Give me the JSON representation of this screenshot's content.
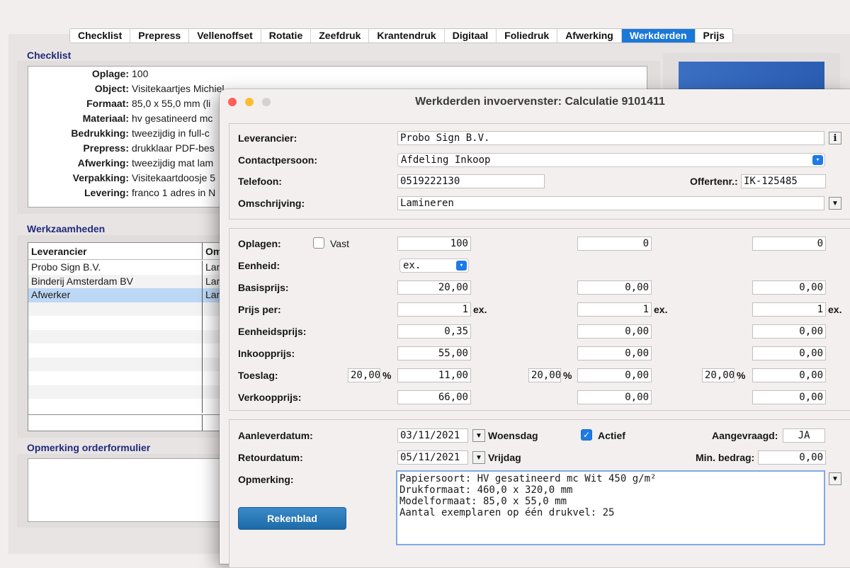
{
  "tabs": [
    "Checklist",
    "Prepress",
    "Vellenoffset",
    "Rotatie",
    "Zeefdruk",
    "Krantendruk",
    "Digitaal",
    "Foliedruk",
    "Afwerking",
    "Werkderden",
    "Prijs"
  ],
  "checklist": {
    "title": "Checklist",
    "rows": [
      {
        "label": "Oplage:",
        "value": "100"
      },
      {
        "label": "Object:",
        "value": "Visitekaartjes Michiel"
      },
      {
        "label": "Formaat:",
        "value": "85,0 x 55,0 mm (li"
      },
      {
        "label": "Materiaal:",
        "value": "hv gesatineerd mc"
      },
      {
        "label": "Bedrukking:",
        "value": "tweezijdig in full-c"
      },
      {
        "label": "Prepress:",
        "value": "drukklaar PDF-bes"
      },
      {
        "label": "Afwerking:",
        "value": "tweezijdig mat lam"
      },
      {
        "label": "Verpakking:",
        "value": "Visitekaartdoosje 5"
      },
      {
        "label": "Levering:",
        "value": "franco 1 adres in N"
      }
    ]
  },
  "werkzaamheden": {
    "title": "Werkzaamheden",
    "headers": [
      "Leverancier",
      "Om"
    ],
    "rows": [
      {
        "leverancier": "Probo Sign B.V.",
        "om": "Lam"
      },
      {
        "leverancier": "Binderij Amsterdam BV",
        "om": "Lam"
      },
      {
        "leverancier": "Afwerker",
        "om": "Lam"
      }
    ]
  },
  "opmerking_orderformulier": {
    "title": "Opmerking orderformulier"
  },
  "dialog": {
    "title": "Werkderden invoervenster: Calculatie 9101411",
    "leverancier": {
      "label": "Leverancier:",
      "value": "Probo Sign B.V.",
      "info_btn": "i"
    },
    "contactpersoon": {
      "label": "Contactpersoon:",
      "value": "Afdeling Inkoop"
    },
    "telefoon": {
      "label": "Telefoon:",
      "value": "0519222130"
    },
    "offertenr": {
      "label": "Offertenr.:",
      "value": "IK-125485"
    },
    "omschrijving": {
      "label": "Omschrijving:",
      "value": "Lamineren"
    },
    "oplagen": {
      "label": "Oplagen:",
      "vast": "Vast",
      "values": [
        "100",
        "0",
        "0"
      ]
    },
    "eenheid": {
      "label": "Eenheid:",
      "value": "ex."
    },
    "basisprijs": {
      "label": "Basisprijs:",
      "values": [
        "20,00",
        "0,00",
        "0,00"
      ]
    },
    "prijs_per": {
      "label": "Prijs per:",
      "values": [
        "1",
        "1",
        "1"
      ],
      "unit": "ex."
    },
    "eenheidsprijs": {
      "label": "Eenheidsprijs:",
      "values": [
        "0,35",
        "0,00",
        "0,00"
      ]
    },
    "inkoopprijs": {
      "label": "Inkoopprijs:",
      "values": [
        "55,00",
        "0,00",
        "0,00"
      ]
    },
    "toeslag": {
      "label": "Toeslag:",
      "percent": [
        "20,00",
        "20,00",
        "20,00"
      ],
      "pct_sign": "%",
      "values": [
        "11,00",
        "0,00",
        "0,00"
      ]
    },
    "verkoopprijs": {
      "label": "Verkoopprijs:",
      "values": [
        "66,00",
        "0,00",
        "0,00"
      ]
    },
    "aanleverdatum": {
      "label": "Aanleverdatum:",
      "date": "03/11/2021",
      "day": "Woensdag"
    },
    "actief": {
      "label": "Actief",
      "checked": true
    },
    "aangevraagd": {
      "label": "Aangevraagd:",
      "value": "JA"
    },
    "retourdatum": {
      "label": "Retourdatum:",
      "date": "05/11/2021",
      "day": "Vrijdag"
    },
    "min_bedrag": {
      "label": "Min. bedrag:",
      "value": "0,00"
    },
    "opmerking": {
      "label": "Opmerking:",
      "text": "Papiersoort: HV gesatineerd mc Wit 450 g/m²\nDrukformaat: 460,0 x 320,0 mm\nModelformaat: 85,0 x 55,0 mm\nAantal exemplaren op één drukvel: 25"
    },
    "rekenblad_btn": "Rekenblad"
  },
  "colors": {
    "accent": "#1a78d8",
    "section_title": "#1f2a7a",
    "close": "#ff5f57",
    "minimize": "#febc2e",
    "zoom": "#d6d1d1"
  }
}
